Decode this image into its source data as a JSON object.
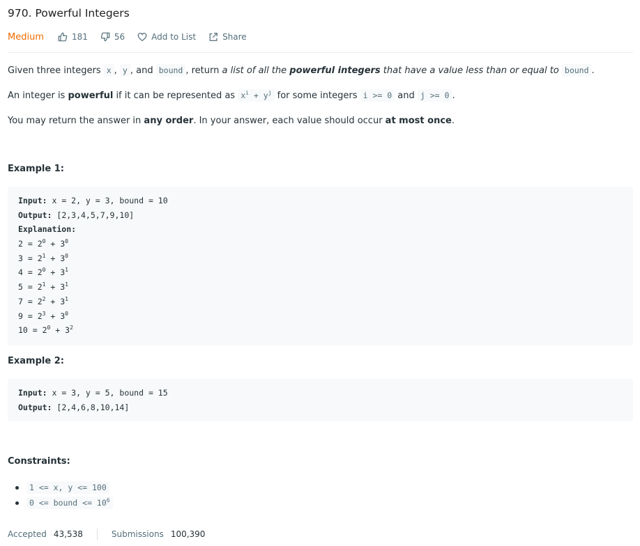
{
  "problem": {
    "title": "970. Powerful Integers",
    "difficulty": "Medium",
    "likes": "181",
    "dislikes": "56",
    "add_to_list": "Add to List",
    "share": "Share"
  },
  "description": {
    "p1": {
      "t1": "Given three integers ",
      "c1": "x",
      "t2": ", ",
      "c2": "y",
      "t3": ", and ",
      "c3": "bound",
      "t4": ", return ",
      "i1": "a list of all the ",
      "b1": "powerful integers",
      "i2": " that have a value less than or equal to",
      "t5": " ",
      "c4": "bound",
      "t6": "."
    },
    "p2": {
      "t1": "An integer is ",
      "b1": "powerful",
      "t2": " if it can be represented as ",
      "c1a": "x",
      "c1b": "i",
      "c1c": " + y",
      "c1d": "j",
      "t3": " for some integers ",
      "c2": "i >= 0",
      "t4": " and ",
      "c3": "j >= 0",
      "t5": "."
    },
    "p3": {
      "t1": "You may return the answer in ",
      "b1": "any order",
      "t2": ". In your answer, each value should occur ",
      "b2": "at most once",
      "t3": "."
    }
  },
  "examples": [
    {
      "heading": "Example 1:",
      "input_label": "Input:",
      "input_value": " x = 2, y = 3, bound = 10",
      "output_label": "Output:",
      "output_value": " [2,3,4,5,7,9,10]",
      "explanation_label": "Explanation:",
      "lines": [
        {
          "lhs": "2 = 2",
          "e1": "0",
          "mid": " + 3",
          "e2": "0"
        },
        {
          "lhs": "3 = 2",
          "e1": "1",
          "mid": " + 3",
          "e2": "0"
        },
        {
          "lhs": "4 = 2",
          "e1": "0",
          "mid": " + 3",
          "e2": "1"
        },
        {
          "lhs": "5 = 2",
          "e1": "1",
          "mid": " + 3",
          "e2": "1"
        },
        {
          "lhs": "7 = 2",
          "e1": "2",
          "mid": " + 3",
          "e2": "1"
        },
        {
          "lhs": "9 = 2",
          "e1": "3",
          "mid": " + 3",
          "e2": "0"
        },
        {
          "lhs": "10 = 2",
          "e1": "0",
          "mid": " + 3",
          "e2": "2"
        }
      ]
    },
    {
      "heading": "Example 2:",
      "input_label": "Input:",
      "input_value": " x = 3, y = 5, bound = 15",
      "output_label": "Output:",
      "output_value": " [2,4,6,8,10,14]"
    }
  ],
  "constraints": {
    "heading": "Constraints:",
    "c1": "1 <= x, y <= 100",
    "c2_base": "0 <= bound <= 10",
    "c2_exp": "6"
  },
  "stats": {
    "accepted_label": "Accepted",
    "accepted_value": "43,538",
    "submissions_label": "Submissions",
    "submissions_value": "100,390"
  }
}
